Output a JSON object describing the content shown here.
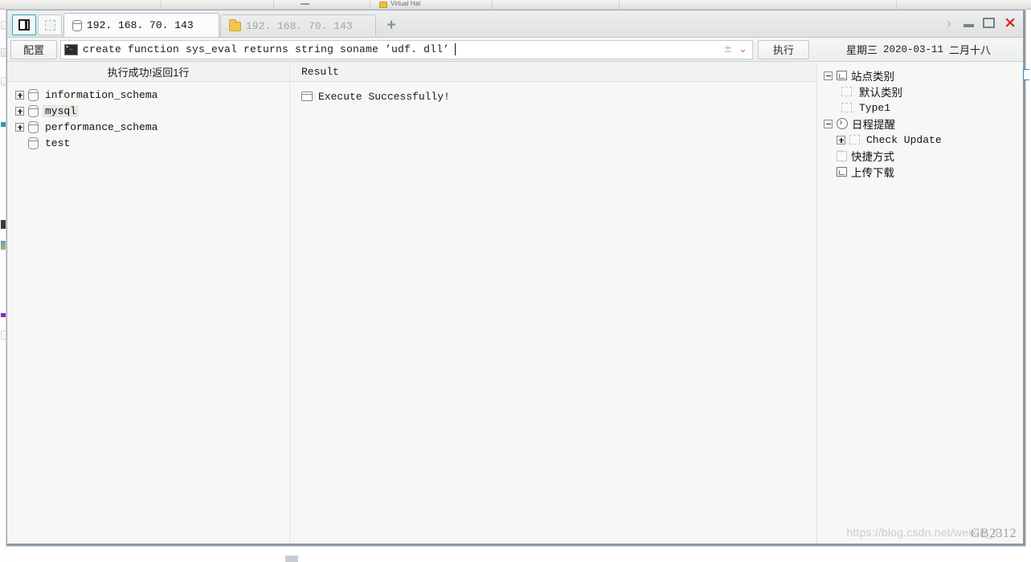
{
  "background": {
    "top_window_item_label": "Virtual Hat",
    "left_strip_note": ""
  },
  "window": {
    "controls": {
      "chevron": "›",
      "minimize": "minimize-icon",
      "maximize": "maximize-icon",
      "close": "×"
    }
  },
  "tabs": {
    "panel_toggle_icon": "panel-layout-icon",
    "select_icon": "dashed-select-icon",
    "items": [
      {
        "label": "192. 168. 70. 143",
        "icon": "database-icon",
        "active": true
      },
      {
        "label": "192. 168. 70. 143",
        "icon": "folder-icon",
        "active": false
      }
    ],
    "new_tab_label": "+"
  },
  "toolbar": {
    "config_label": "配置",
    "console_icon": "console-icon",
    "command_value": "create function sys_eval returns string soname ’udf. dll’",
    "command_placeholder": "",
    "plusminus_icon": "±",
    "dropdown_icon": "⌄",
    "execute_label": "执行"
  },
  "datebar": {
    "weekday": "星期三",
    "date": "2020-03-11",
    "lunar": "二月十八"
  },
  "left_panel": {
    "header": "执行成功!返回1行",
    "tree": [
      {
        "label": "information_schema",
        "expander": "plus",
        "icon": "database-icon",
        "selected": false
      },
      {
        "label": "mysql",
        "expander": "plus",
        "icon": "database-icon",
        "selected": true
      },
      {
        "label": "performance_schema",
        "expander": "plus",
        "icon": "database-icon",
        "selected": false
      },
      {
        "label": "test",
        "expander": "none",
        "icon": "database-icon",
        "selected": false
      }
    ]
  },
  "result_panel": {
    "header": "Result",
    "items": [
      {
        "label": "Execute Successfully!",
        "icon": "window-icon"
      }
    ]
  },
  "right_panel": {
    "tree": [
      {
        "label": "站点类别",
        "expander": "minus",
        "icon": "square-icon",
        "indent": 0
      },
      {
        "label": "默认类别",
        "expander": "none",
        "icon": "dashed-square-icon",
        "indent": 1
      },
      {
        "label": "Type1",
        "expander": "none",
        "icon": "dashed-square-icon",
        "indent": 1,
        "mono": true
      },
      {
        "label": "日程提醒",
        "expander": "minus",
        "icon": "clock-icon",
        "indent": 0
      },
      {
        "label": "Check Update",
        "expander": "plus",
        "icon": "dashed-square-icon",
        "indent": 2,
        "mono": true
      },
      {
        "label": "快捷方式",
        "expander": "none",
        "icon": "hand-icon",
        "indent": 0
      },
      {
        "label": "上传下载",
        "expander": "none",
        "icon": "square-icon",
        "indent": 0
      }
    ]
  },
  "footer": {
    "watermark": "https://blog.csdn.net/weixin_4",
    "charset": "GB2312"
  },
  "colors": {
    "accent": "#2aa6bf",
    "close_red": "#e02020",
    "folder_yellow": "#f2c64d",
    "newtab_blue": "#7d8fa0"
  }
}
